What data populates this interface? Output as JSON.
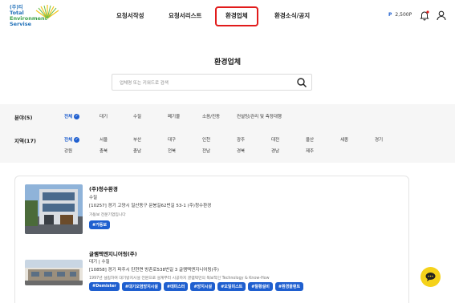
{
  "logo": {
    "company": "(주)티",
    "line1": "Total",
    "line2": "Environment",
    "line3": "Servise"
  },
  "nav": [
    {
      "label": "요청서작성"
    },
    {
      "label": "요청서리스트"
    },
    {
      "label": "환경업체"
    },
    {
      "label": "환경소식/공지"
    }
  ],
  "header": {
    "point_symbol": "P",
    "point_value": "2,500P",
    "bell_icon": "bell-icon",
    "user_icon": "user-icon"
  },
  "page": {
    "title": "환경업체"
  },
  "search": {
    "placeholder": "업체명 또는 키워드로 검색",
    "icon": "search-icon"
  },
  "filters": {
    "field": {
      "label": "분야(5)",
      "items": [
        "전체",
        "대기",
        "수질",
        "폐기물",
        "소음/진동",
        "컨설팅/관리 및 측정대행"
      ]
    },
    "region": {
      "label": "지역(17)",
      "row1": [
        "전체",
        "서울",
        "부산",
        "대구",
        "인천",
        "광주",
        "대전",
        "울산",
        "세종",
        "경기"
      ],
      "row2": [
        "강원",
        "충북",
        "충남",
        "전북",
        "전남",
        "경북",
        "경남",
        "제주"
      ]
    }
  },
  "companies": [
    {
      "name": "(주)청수환경",
      "category": "수질",
      "address": "[10257] 경기 고양시 일산동구 문봉길62번길 53-1 (주)청수환경",
      "description": "가동보 전문기업입니다",
      "tags": [
        "#가동보"
      ]
    },
    {
      "name": "글램텍엔지니어링(주)",
      "category": "대기 | 수질",
      "address": "[10858] 경기 파주시 탄현면 방촌로538번길 3 글램텍엔지니어링(주)",
      "description": "1997년 설립하여 대기방지시설 전문으로 설계부터 시공까지 글램텍만의 독보적인 Technology & Know-How",
      "tags": [
        "#Demister",
        "#대기오염방지시설",
        "#데미스터",
        "#방지시설",
        "#오일미스트",
        "#탈황설비",
        "#환경플랜트"
      ]
    }
  ],
  "colors": {
    "accent": "#1f5fcf",
    "highlight_border": "#e11b1b",
    "chat_button": "#f5d21a",
    "filter_bg": "#f6f6f6"
  }
}
